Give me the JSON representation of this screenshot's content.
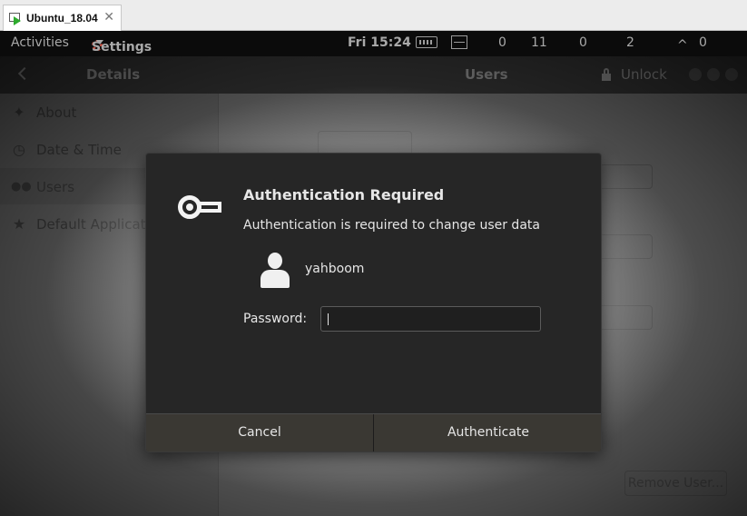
{
  "vbox": {
    "tab_title": "Ubuntu_18.04",
    "close_glyph": "✕"
  },
  "topbar": {
    "activities": "Activities",
    "app_menu": "Settings",
    "clock": "Fri 15:24",
    "indicators": [
      "0",
      "11",
      "0",
      "2",
      "0"
    ],
    "tray_glyph": "^"
  },
  "header": {
    "left_title": "Details",
    "center_title": "Users",
    "unlock_label": "Unlock"
  },
  "sidebar": {
    "items": [
      {
        "label": "About",
        "icon": "star-icon"
      },
      {
        "label": "Date & Time",
        "icon": "clock-icon"
      },
      {
        "label": "Users",
        "icon": "users-icon",
        "selected": true
      },
      {
        "label": "Default Applications",
        "icon": "star-icon"
      }
    ]
  },
  "users_panel": {
    "username": "yahboom",
    "remove_user": "Remove User..."
  },
  "dialog": {
    "title": "Authentication Required",
    "message": "Authentication is required to change user data",
    "user": "yahboom",
    "password_label": "Password:",
    "password_value": "",
    "cancel": "Cancel",
    "authenticate": "Authenticate"
  },
  "colors": {
    "dialog_bg": "#262626",
    "button_bg": "#3a3833",
    "topbar_bg": "#0b0b0b"
  }
}
